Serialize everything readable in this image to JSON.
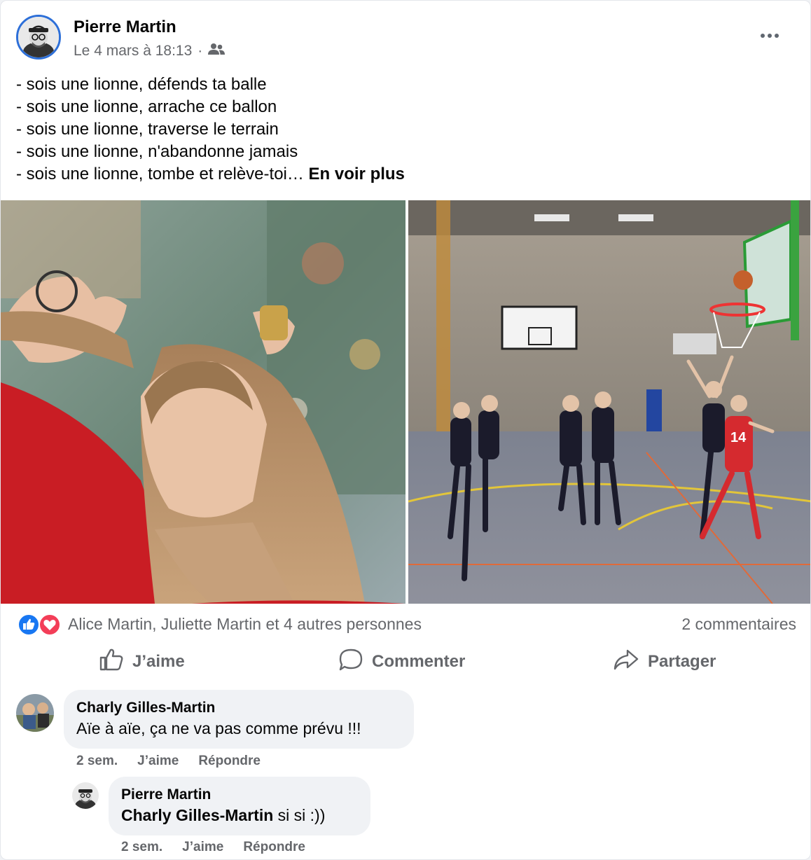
{
  "post": {
    "author": "Pierre Martin",
    "date": "Le 4 mars à 18:13",
    "separator": "·",
    "audience_icon": "friends-icon",
    "lines": [
      "- sois une lionne, défends ta balle",
      "- sois une lionne, arrache ce ballon",
      "- sois une lionne, traverse le terrain",
      "- sois une lionne, n'abandonne jamais",
      "- sois une lionne, tombe et relève-toi…"
    ],
    "see_more": "En voir plus"
  },
  "reactions": {
    "icons": [
      "like-icon",
      "love-icon"
    ],
    "summary": "Alice Martin, Juliette Martin et 4 autres personnes",
    "comments_count": "2 commentaires"
  },
  "actions": {
    "like": "J’aime",
    "comment": "Commenter",
    "share": "Partager"
  },
  "comments": [
    {
      "author": "Charly Gilles-Martin",
      "text": "Aïe à aïe, ça ne va pas comme prévu !!!",
      "time": "2 sem.",
      "like": "J’aime",
      "reply": "Répondre"
    },
    {
      "author": "Pierre Martin",
      "tag": "Charly Gilles-Martin",
      "text": "si si :))",
      "time": "2 sem.",
      "like": "J’aime",
      "reply": "Répondre"
    }
  ],
  "colors": {
    "like_blue": "#1877f2",
    "love_red": "#f33e58",
    "secondary_text": "#65676b",
    "bubble_bg": "#f0f2f5"
  }
}
